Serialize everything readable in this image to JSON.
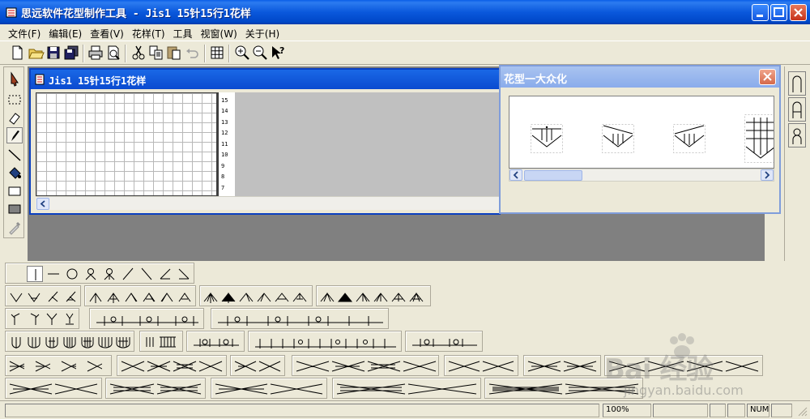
{
  "window": {
    "title": "思远软件花型制作工具 - Jis1 15针15行1花样"
  },
  "menu": {
    "items": [
      "文件(F)",
      "编辑(E)",
      "查看(V)",
      "花样(T)",
      "工具",
      "视窗(W)",
      "关于(H)"
    ]
  },
  "toolbar": {
    "icons": [
      "new-file-icon",
      "open-folder-icon",
      "save-icon",
      "save-all-icon",
      "print-icon",
      "print-preview-icon",
      "cut-icon",
      "copy-icon",
      "paste-icon",
      "undo-icon",
      "grid-icon",
      "zoom-in-icon",
      "zoom-out-icon",
      "context-help-icon"
    ]
  },
  "left_palette": {
    "tools": [
      "select-arrow-icon",
      "marquee-select-icon",
      "eraser-icon",
      "pencil-icon",
      "line-icon",
      "fill-bucket-icon",
      "rectangle-icon",
      "filled-rectangle-icon",
      "eyedropper-icon"
    ],
    "active": "pencil-icon"
  },
  "child_window": {
    "title": "Jis1 15针15行1花样",
    "row_numbers": [
      "15",
      "14",
      "13",
      "12",
      "11",
      "10",
      "9",
      "8",
      "7"
    ]
  },
  "float_window": {
    "title": "花型一大众化",
    "patterns": [
      "pattern-1",
      "pattern-2",
      "pattern-3",
      "pattern-4"
    ]
  },
  "status_bar": {
    "zoom": "100%",
    "num": "NUM"
  },
  "watermark": {
    "brand": "Bai 经验",
    "site": "jingyan.baidu.com"
  }
}
